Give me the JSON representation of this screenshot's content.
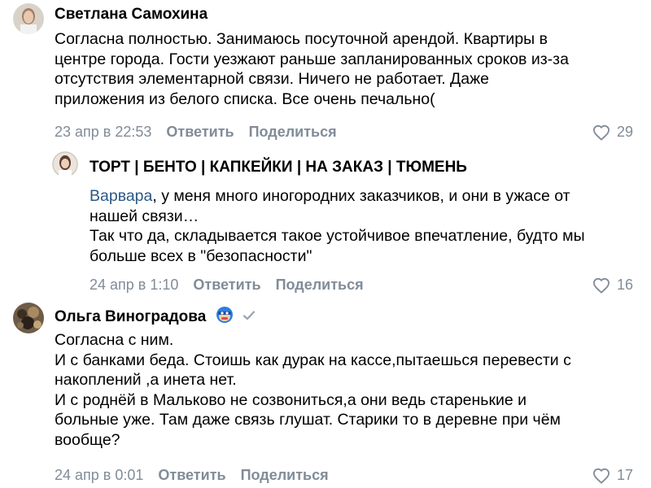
{
  "comments": [
    {
      "author": "Светлана Самохина",
      "lines": [
        "Согласна полностью. Занимаюсь посуточной арендой. Квартиры в",
        "центре города. Гости уезжают раньше запланированных сроков из-за",
        "отсутствия элементарной связи. Ничего не работает. Даже",
        "приложения из белого списка. Все очень печально("
      ],
      "date": "23 апр в 22:53",
      "reply_label": "Ответить",
      "share_label": "Поделиться",
      "likes": "29"
    },
    {
      "author": "ТОРТ | БЕНТО | КАПКЕЙКИ | НА ЗАКАЗ | ТЮМЕНЬ",
      "mention": "Варвара",
      "lines": [
        ", у меня много иногородних заказчиков, и они в ужасе от",
        "нашей связи…",
        "Так что да, складывается такое устойчивое впечатление, будто мы",
        "больше всех в \"безопасности\""
      ],
      "date": "24 апр в 1:10",
      "reply_label": "Ответить",
      "share_label": "Поделиться",
      "likes": "16"
    },
    {
      "author": "Ольга Виноградова",
      "lines": [
        "Согласна с ним.",
        "И с банками беда. Стоишь как дурак на кассе,пытаешься перевести с",
        "накоплений ,а инета нет.",
        "И с роднёй в Мальково не созвониться,а они ведь старенькие и",
        "больные уже. Там даже связь глушат. Старики то в деревне при чём",
        "вообще?"
      ],
      "date": "24 апр в 0:01",
      "reply_label": "Ответить",
      "share_label": "Поделиться",
      "likes": "17"
    }
  ],
  "colors": {
    "meta": "#818c99",
    "mention": "#2a5885",
    "text": "#000000"
  },
  "icons": {
    "like": "heart-outline-icon",
    "verified": "checkmark-icon",
    "emoji": "mask-emoji-icon"
  }
}
